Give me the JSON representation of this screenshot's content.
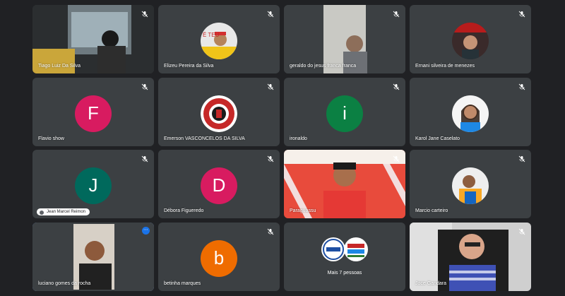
{
  "participants": [
    {
      "name": "Tiago Luiz Da Silva"
    },
    {
      "name": "Elizeu Pereira da Silva"
    },
    {
      "name": "geraldo do jesus franca franca"
    },
    {
      "name": "Ernani silveira de menezes"
    },
    {
      "name": "Flavio show",
      "initial": "F",
      "color": "#d81b60"
    },
    {
      "name": "Emerson VASCONCELOS DA SILVA"
    },
    {
      "name": "ironaldo",
      "initial": "i",
      "color": "#0b8043"
    },
    {
      "name": "Karol Jane Caselato"
    },
    {
      "name": "Jean Marcel Reimon",
      "initial": "J",
      "color": "#00695c"
    },
    {
      "name": "Débora Figueredo",
      "initial": "D",
      "color": "#d81b60"
    },
    {
      "name": "Paraguassu"
    },
    {
      "name": "Marcio carteiro"
    },
    {
      "name": "luciano gomes da rocha"
    },
    {
      "name": "betinha marques",
      "initial": "b",
      "color": "#ef6c00"
    },
    {
      "name": "Mais 7 pessoas"
    },
    {
      "name": "Joce Gandara"
    }
  ],
  "more_options_icon": "⋯",
  "colors": {
    "background": "#202124",
    "tile": "#3c4043",
    "active_border": "#8ab4f8"
  }
}
